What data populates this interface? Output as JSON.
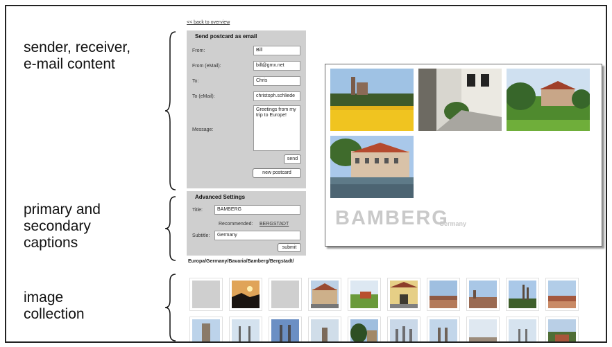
{
  "annotations": {
    "sender": [
      "sender, receiver,",
      "e-mail content"
    ],
    "captions": [
      "primary and",
      "secondary",
      "captions"
    ],
    "collection": [
      "image",
      "collection"
    ]
  },
  "back_link": "<< back to overview",
  "email_form": {
    "title": "Send postcard as email",
    "from_label": "From:",
    "from_value": "Bill",
    "from_email_label": "From (eMail):",
    "from_email_value": "bill@gmx.net",
    "to_label": "To:",
    "to_value": "Chris",
    "to_email_label": "To (eMail):",
    "to_email_value": "christoph.schliede",
    "message_label": "Message:",
    "message_value": "Greetings from my trip to Europe!",
    "send_button": "send",
    "new_postcard_button": "new postcard"
  },
  "advanced": {
    "title": "Advanced Settings",
    "title_label": "Title:",
    "title_value": "BAMBERG",
    "recommended_label": "Recommended:",
    "recommended_value": "BERGSTADT",
    "subtitle_label": "Subtitle:",
    "subtitle_value": "Germany",
    "submit_button": "submit"
  },
  "path": "Europa/Germany/Bavaria/Bamberg/Bergstadt/",
  "postcard": {
    "title": "BAMBERG",
    "subtitle": "Germany"
  },
  "colors": {
    "panel": "#cfcfcf",
    "caption_gray": "#c9c9c9"
  }
}
